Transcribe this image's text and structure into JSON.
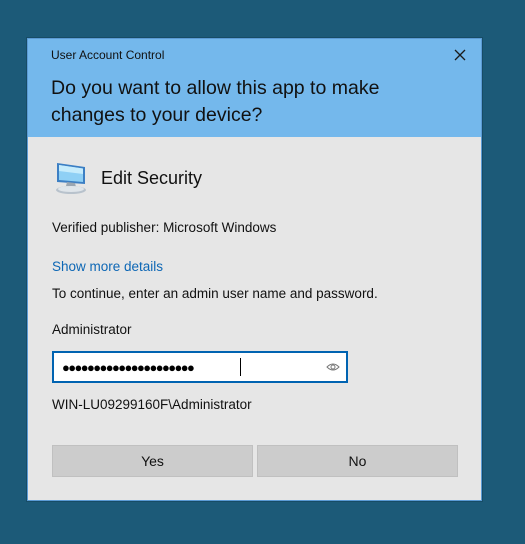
{
  "dialog": {
    "caption": "User Account Control",
    "question": "Do you want to allow this app to make changes to your device?",
    "app_name": "Edit Security",
    "publisher": "Verified publisher: Microsoft Windows",
    "details_link": "Show more details",
    "instruction": "To continue, enter an admin user name and password.",
    "username": "Administrator",
    "password_masked": "●●●●●●●●●●●●●●●●●●●●●",
    "domain_user": "WIN-LU09299160F\\Administrator",
    "yes_label": "Yes",
    "no_label": "No"
  },
  "colors": {
    "desktop": "#1c5a78",
    "header": "#74b8ec",
    "body": "#e6e6e6",
    "link": "#0d67b5",
    "focus_border": "#0063b1",
    "button": "#cccccc"
  },
  "icons": {
    "close": "close-icon",
    "app": "computer-monitor-icon",
    "reveal": "eye-icon"
  }
}
